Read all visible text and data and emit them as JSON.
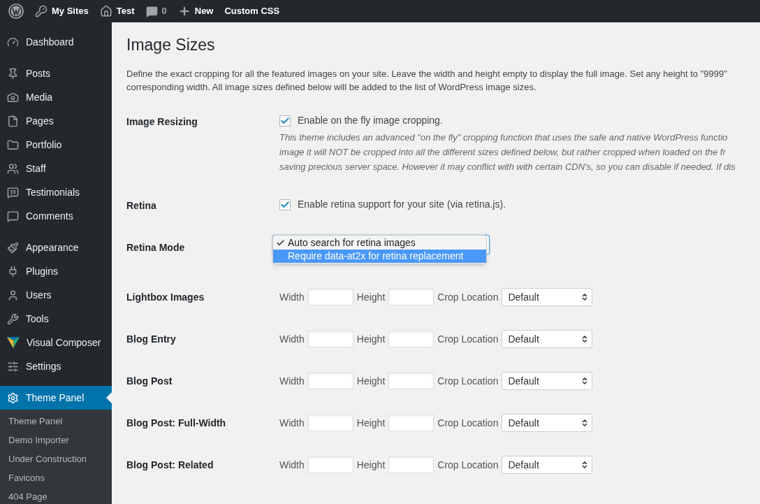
{
  "admin_bar": {
    "items": [
      {
        "kind": "logo"
      },
      {
        "kind": "sites",
        "label": "My Sites"
      },
      {
        "kind": "home",
        "label": "Test"
      },
      {
        "kind": "comments",
        "label": "0"
      },
      {
        "kind": "new",
        "label": "New"
      },
      {
        "kind": "text",
        "label": "Custom CSS"
      }
    ]
  },
  "sidebar": {
    "groups": [
      [
        {
          "kind": "dashboard",
          "label": "Dashboard",
          "selected": false
        }
      ],
      [
        {
          "kind": "posts",
          "label": "Posts",
          "selected": false
        },
        {
          "kind": "media",
          "label": "Media",
          "selected": false
        },
        {
          "kind": "pages",
          "label": "Pages",
          "selected": false
        },
        {
          "kind": "portfolio",
          "label": "Portfolio",
          "selected": false
        },
        {
          "kind": "staff",
          "label": "Staff",
          "selected": false
        },
        {
          "kind": "testimonials",
          "label": "Testimonials",
          "selected": false
        },
        {
          "kind": "comments",
          "label": "Comments",
          "selected": false
        }
      ],
      [
        {
          "kind": "appearance",
          "label": "Appearance",
          "selected": false
        },
        {
          "kind": "plugins",
          "label": "Plugins",
          "selected": false
        },
        {
          "kind": "users",
          "label": "Users",
          "selected": false
        },
        {
          "kind": "tools",
          "label": "Tools",
          "selected": false
        },
        {
          "kind": "vc",
          "label": "Visual Composer",
          "selected": false
        },
        {
          "kind": "settings",
          "label": "Settings",
          "selected": false
        }
      ],
      [
        {
          "kind": "gear",
          "label": "Theme Panel",
          "selected": true,
          "children": [
            "Theme Panel",
            "Demo Importer",
            "Under Construction",
            "Favicons",
            "404 Page"
          ]
        }
      ]
    ]
  },
  "page": {
    "title": "Image Sizes",
    "intro": [
      "Define the exact cropping for all the featured images on your site. Leave the width and height empty to display the full image. Set any height to \"9999\"",
      "corresponding width. All image sizes defined below will be added to the list of WordPress image sizes."
    ],
    "rows": [
      {
        "kind": "checkbox",
        "label": "Image Resizing",
        "checked": true,
        "text": "Enable on the fly image cropping.",
        "description": [
          "This theme includes an advanced \"on the fly\" cropping function that uses the safe and native WordPress functio",
          "image it will NOT be cropped into all the different sizes defined below, but rather cropped when loaded on the fr",
          "saving precious server space. However it may conflict with with certain CDN's, so you can disable if needed. If dis"
        ]
      },
      {
        "kind": "checkbox",
        "label": "Retina",
        "checked": true,
        "text": "Enable retina support for your site (via retina.js)."
      },
      {
        "kind": "dropdown",
        "label": "Retina Mode",
        "options": [
          {
            "label": "Auto search for retina images",
            "checked": true,
            "selected": false
          },
          {
            "label": "Require data-at2x for retina replacement",
            "checked": false,
            "selected": true
          }
        ]
      },
      {
        "kind": "size",
        "label": "Lightbox Images",
        "width_label": "Width",
        "height_label": "Height",
        "crop_label": "Crop Location",
        "crop": "Default"
      },
      {
        "kind": "size",
        "label": "Blog Entry",
        "width_label": "Width",
        "height_label": "Height",
        "crop_label": "Crop Location",
        "crop": "Default"
      },
      {
        "kind": "size",
        "label": "Blog Post",
        "width_label": "Width",
        "height_label": "Height",
        "crop_label": "Crop Location",
        "crop": "Default"
      },
      {
        "kind": "size",
        "label": "Blog Post: Full-Width",
        "width_label": "Width",
        "height_label": "Height",
        "crop_label": "Crop Location",
        "crop": "Default"
      },
      {
        "kind": "size",
        "label": "Blog Post: Related",
        "width_label": "Width",
        "height_label": "Height",
        "crop_label": "Crop Location",
        "crop": "Default"
      }
    ]
  }
}
